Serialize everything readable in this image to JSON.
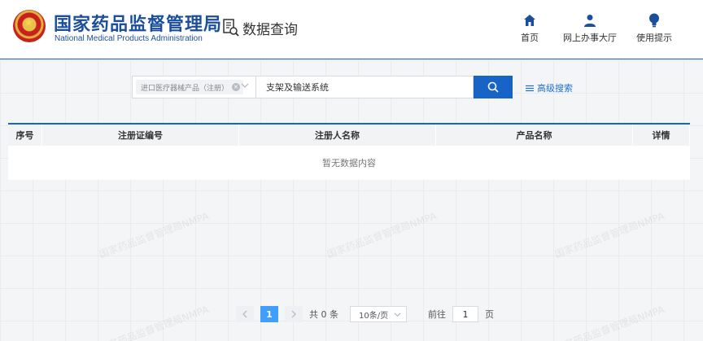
{
  "header": {
    "brand_cn": "国家药品监督管理局",
    "brand_en": "National Medical Products Administration",
    "section_title": "数据查询",
    "nav": [
      {
        "label": "首页",
        "icon": "home-icon"
      },
      {
        "label": "网上办事大厅",
        "icon": "user-icon"
      },
      {
        "label": "使用提示",
        "icon": "lightbulb-icon"
      }
    ]
  },
  "search": {
    "category_tag": "进口医疗器械产品（注册）",
    "value": "支架及输送系统",
    "advanced_label": "高级搜索"
  },
  "table": {
    "columns": [
      "序号",
      "注册证编号",
      "注册人名称",
      "产品名称",
      "详情"
    ],
    "empty_text": "暂无数据内容"
  },
  "pagination": {
    "current_page": "1",
    "total_text": "共 0 条",
    "page_size": "10条/页",
    "goto_label": "前往",
    "goto_value": "1",
    "page_suffix": "页"
  },
  "watermark": "国家药品监督管理局NMPA",
  "colors": {
    "brand": "#1b4f9c",
    "primary_button": "#1764c6",
    "active_page": "#409eff",
    "link": "#1f6fd1"
  }
}
